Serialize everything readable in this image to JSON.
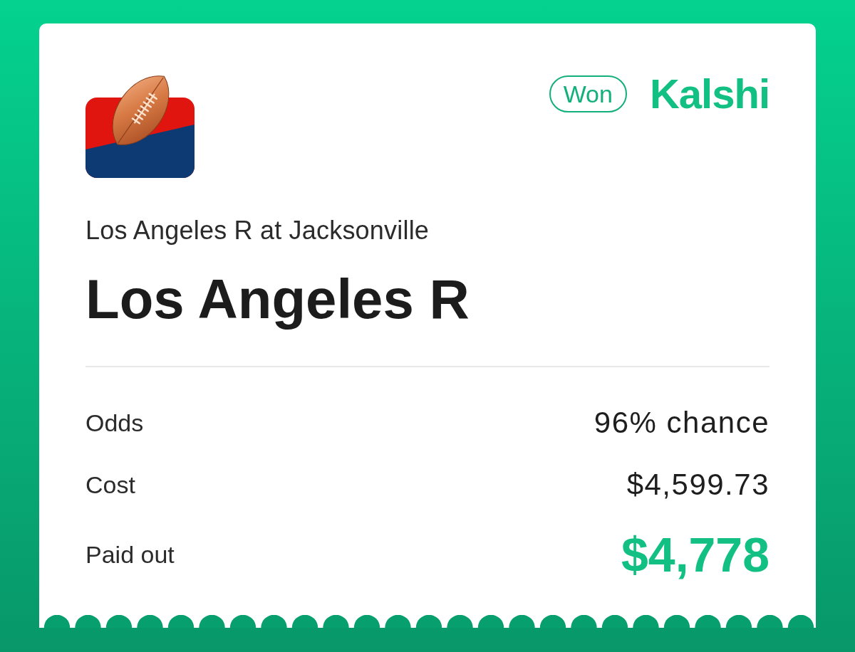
{
  "status_badge": "Won",
  "brand": "Kalshi",
  "event": "Los Angeles R at Jacksonville",
  "outcome": "Los Angeles R",
  "details": [
    {
      "kind": "plain",
      "label": "Odds",
      "value": "96% chance"
    },
    {
      "kind": "plain",
      "label": "Cost",
      "value": "$4,599.73"
    },
    {
      "kind": "payout",
      "label": "Paid out",
      "value": "$4,778"
    }
  ]
}
